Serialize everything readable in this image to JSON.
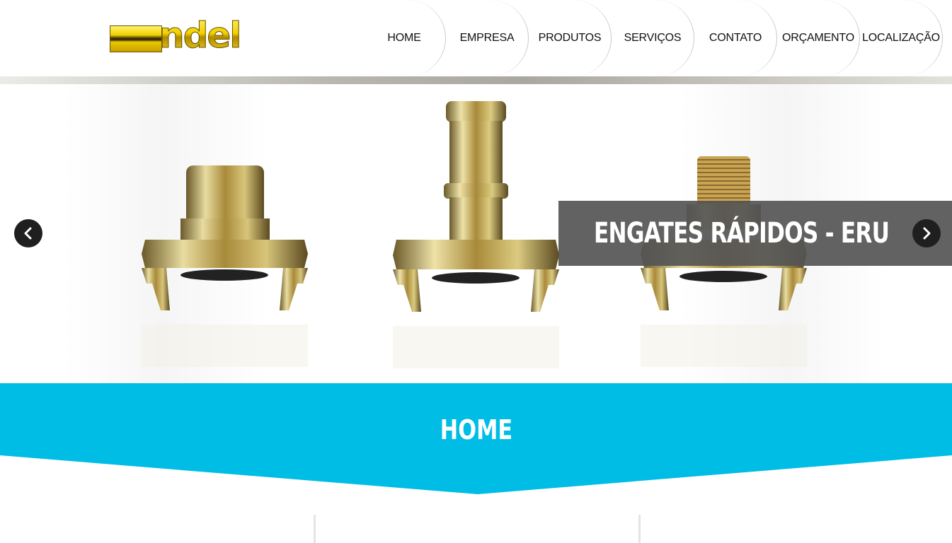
{
  "header": {
    "logo": {
      "text": "ndel"
    },
    "nav": [
      {
        "label": "HOME"
      },
      {
        "label": "EMPRESA"
      },
      {
        "label": "PRODUTOS"
      },
      {
        "label": "SERVIÇOS"
      },
      {
        "label": "CONTATO"
      },
      {
        "label": "ORÇAMENTO"
      },
      {
        "label": "LOCALIZAÇÃO"
      }
    ]
  },
  "slider": {
    "caption": "ENGATES RÁPIDOS - ERU",
    "prev_icon": "chevron-left-icon",
    "next_icon": "chevron-right-icon"
  },
  "section": {
    "title": "HOME"
  },
  "colors": {
    "accent": "#00bde6",
    "caption_bg": "#555555",
    "logo_gold": "#e8c800"
  }
}
